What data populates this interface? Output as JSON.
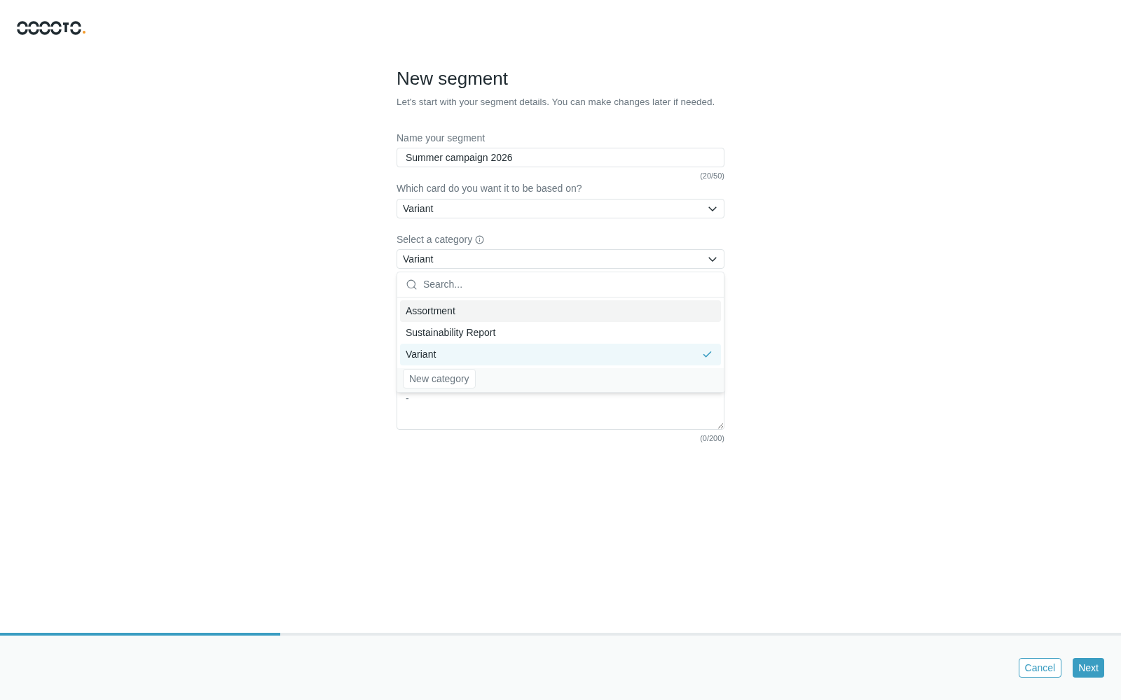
{
  "title": "New segment",
  "subtitle": "Let's start with your segment details. You can make changes later if needed.",
  "name_field": {
    "label": "Name your segment",
    "value": "Summer campaign 2026",
    "counter": "(20/50)"
  },
  "card_select": {
    "label": "Which card do you want it to be based on?",
    "value": "Variant"
  },
  "category_select": {
    "label": "Select a category",
    "value": "Variant",
    "expanded": true,
    "search": {
      "placeholder": "Search..."
    },
    "options": [
      {
        "label": "Assortment",
        "selected": false,
        "hovered": true
      },
      {
        "label": "Sustainability Report",
        "selected": false,
        "hovered": false
      },
      {
        "label": "Variant",
        "selected": true,
        "hovered": false
      }
    ],
    "new_button": "New category"
  },
  "description": {
    "value": "-",
    "counter": "(0/200)"
  },
  "progress": {
    "level": 0.25
  },
  "buttons": [
    {
      "label": "Cancel",
      "kind": "secondary"
    },
    {
      "label": "Next",
      "kind": "primary"
    }
  ]
}
